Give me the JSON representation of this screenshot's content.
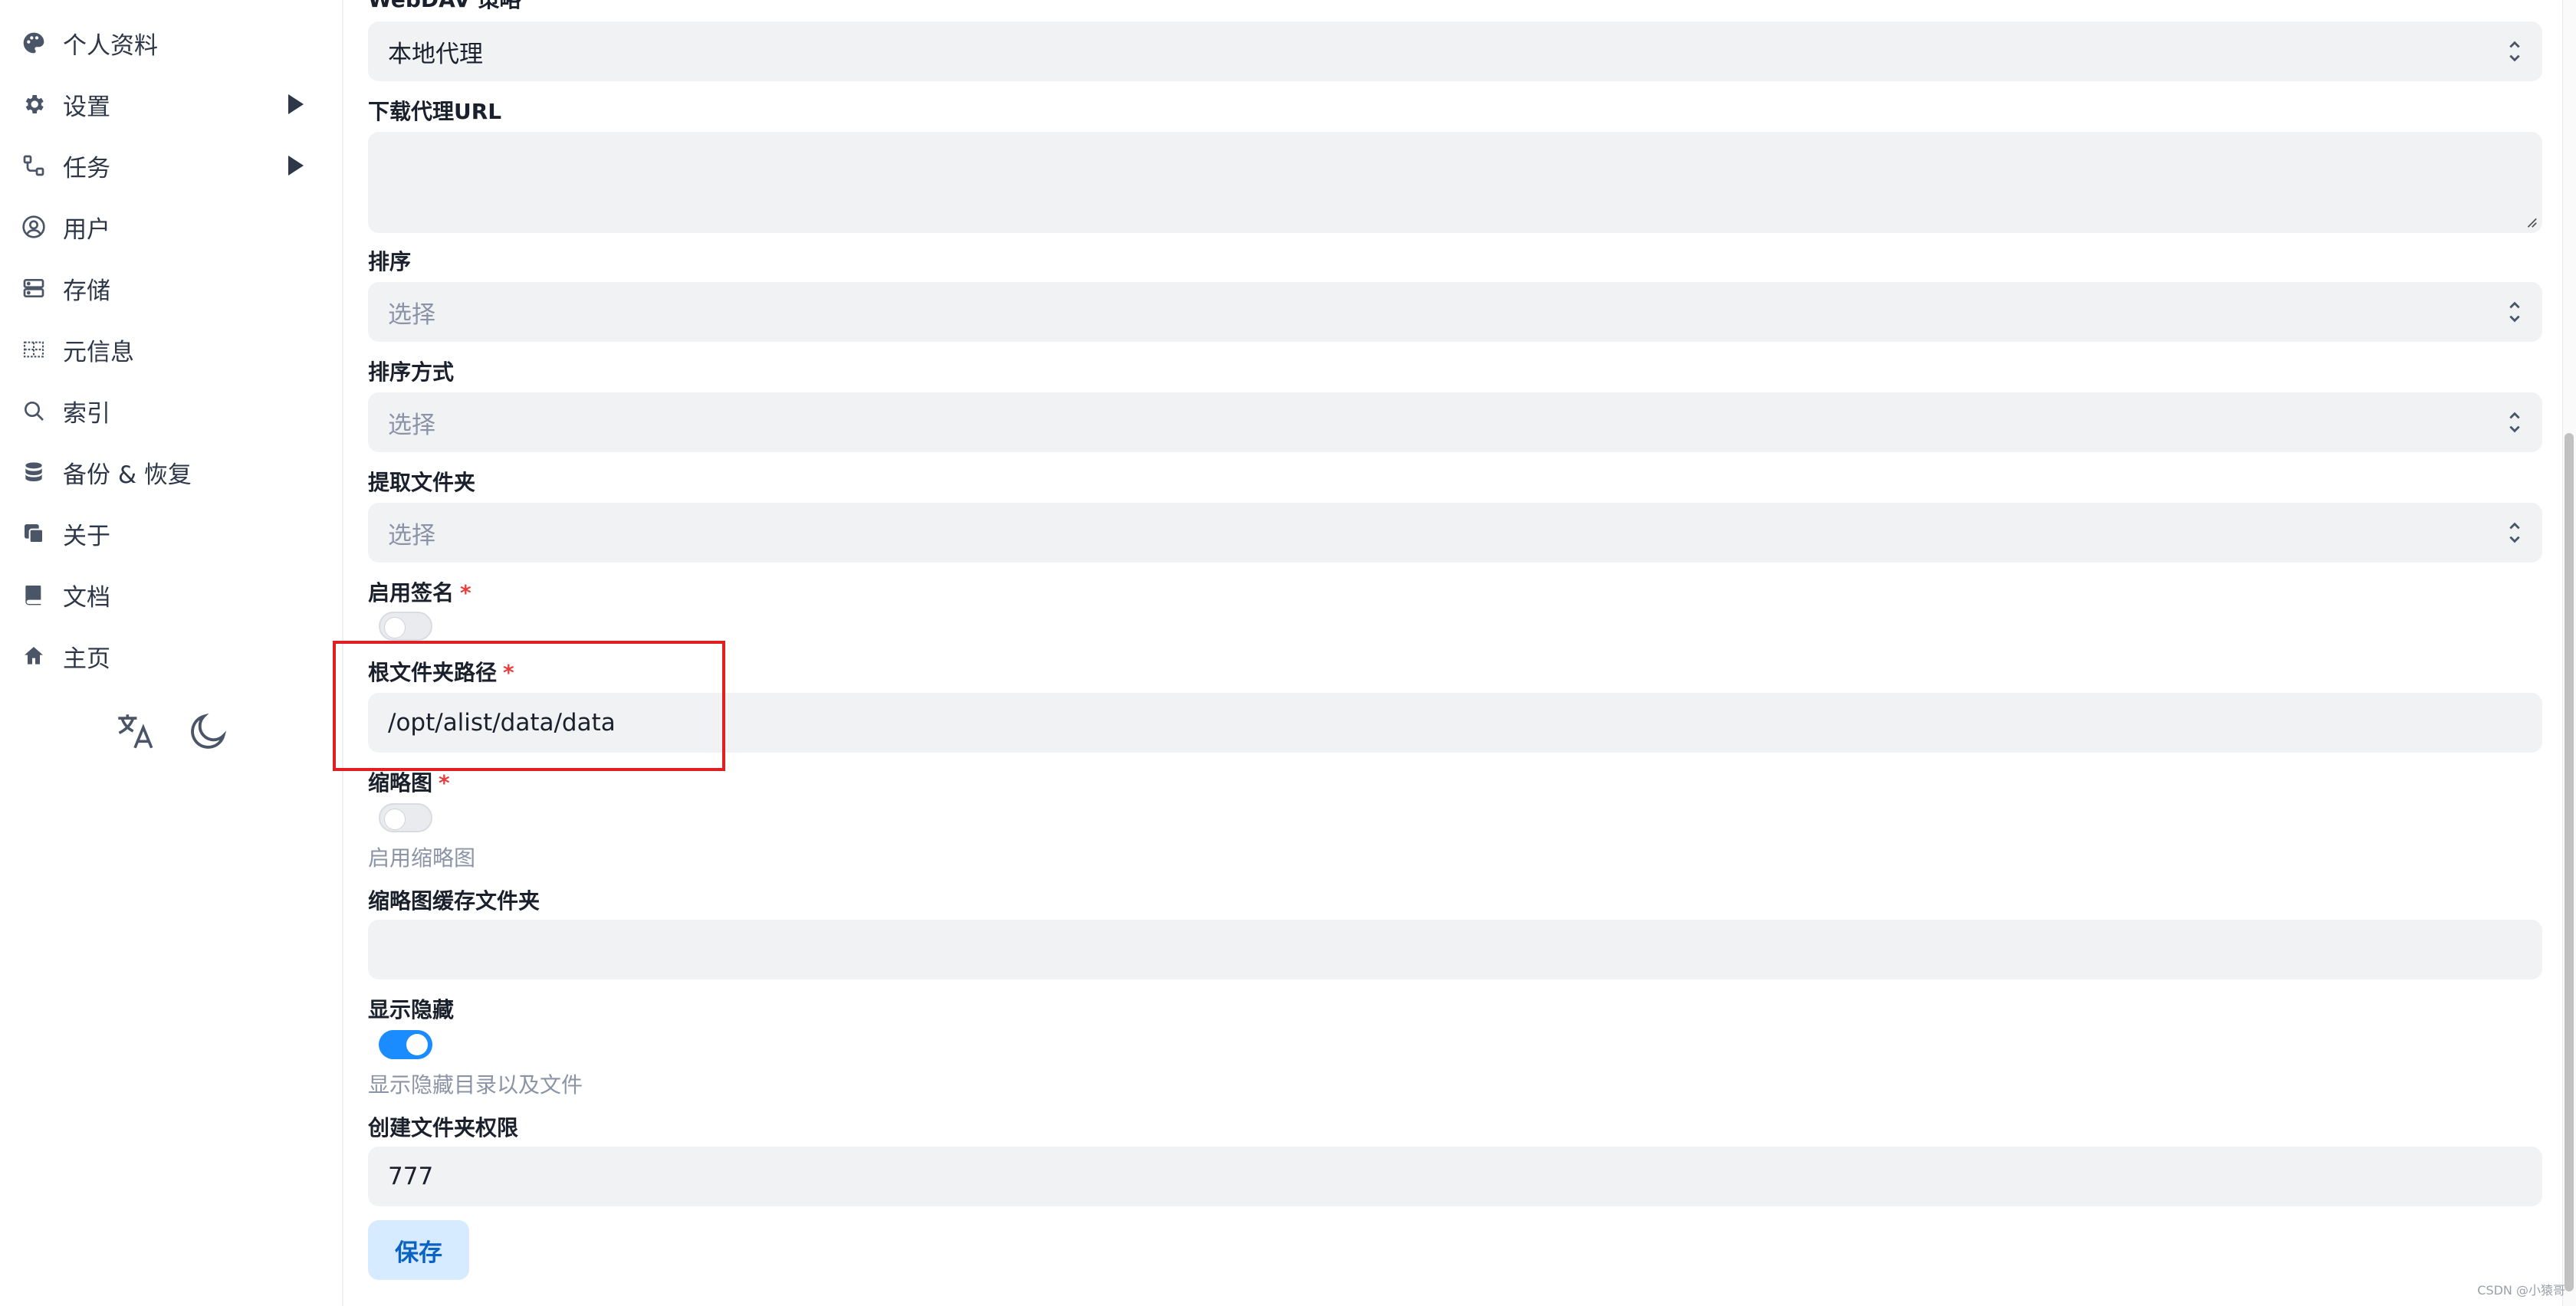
{
  "sidebar": {
    "items": [
      {
        "label": "个人资料",
        "icon": "palette-icon"
      },
      {
        "label": "设置",
        "icon": "gear-icon"
      },
      {
        "label": "任务",
        "icon": "workflow-icon"
      },
      {
        "label": "用户",
        "icon": "user-circle-icon"
      },
      {
        "label": "存储",
        "icon": "storage-icon"
      },
      {
        "label": "元信息",
        "icon": "meta-grid-icon"
      },
      {
        "label": "索引",
        "icon": "search-icon"
      },
      {
        "label": "备份 & 恢复",
        "icon": "database-icon"
      },
      {
        "label": "关于",
        "icon": "copy-icon"
      },
      {
        "label": "文档",
        "icon": "book-icon"
      },
      {
        "label": "主页",
        "icon": "home-icon"
      }
    ],
    "utility": {
      "translate_icon": "translate-icon",
      "theme_icon": "moon-icon"
    }
  },
  "form": {
    "webdav_policy": {
      "label": "WebDAV 策略",
      "value": "本地代理"
    },
    "download_proxy_url": {
      "label": "下载代理URL",
      "value": ""
    },
    "order_by": {
      "label": "排序",
      "placeholder": "选择"
    },
    "order_direction": {
      "label": "排序方式",
      "placeholder": "选择"
    },
    "extract_folder": {
      "label": "提取文件夹",
      "placeholder": "选择"
    },
    "enable_sign": {
      "label": "启用签名",
      "required_mark": "*",
      "enabled": false
    },
    "root_folder_path": {
      "label": "根文件夹路径",
      "required_mark": "*",
      "value": "/opt/alist/data/data"
    },
    "thumbnail": {
      "label": "缩略图",
      "required_mark": "*",
      "enabled": false,
      "help": "启用缩略图"
    },
    "thumb_cache_folder": {
      "label": "缩略图缓存文件夹",
      "value": ""
    },
    "show_hidden": {
      "label": "显示隐藏",
      "enabled": true,
      "help": "显示隐藏目录以及文件"
    },
    "mkdir_perm": {
      "label": "创建文件夹权限",
      "value": "777"
    },
    "save_label": "保存"
  },
  "colors": {
    "accent": "#1a8cff",
    "required": "#e53e3e",
    "highlight_box": "#e02020",
    "field_bg": "#f1f2f4"
  },
  "watermark": "CSDN @小猿哥"
}
